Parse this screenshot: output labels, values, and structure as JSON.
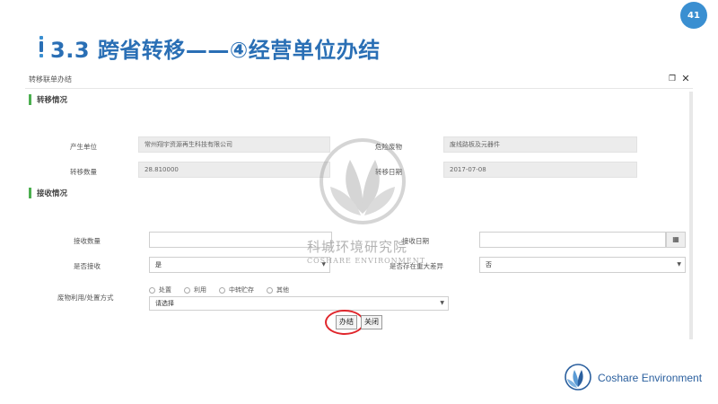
{
  "slide": {
    "title": "3.3 跨省转移——④经营单位办结",
    "page_number": "41",
    "accent_color": "#2a6fb5"
  },
  "dialog": {
    "title": "转移联单办结",
    "restore_icon": "restore-window-icon",
    "close_icon": "close-icon"
  },
  "transfer_section": {
    "heading": "转移情况",
    "producer_label": "产生单位",
    "producer_value": "常州翔宇资源再生科技有限公司",
    "waste_label": "危险废物",
    "waste_value": "废线路板及元器件",
    "quantity_label": "转移数量",
    "quantity_value": "28.810000",
    "date_label": "转移日期",
    "date_value": "2017-07-08"
  },
  "receive_section": {
    "heading": "接收情况",
    "recv_qty_label": "接收数量",
    "recv_qty_value": "",
    "recv_date_label": "接收日期",
    "recv_date_value": "",
    "accepted_label": "是否接收",
    "accepted_value": "是",
    "discrepancy_label": "是否存在重大差异",
    "discrepancy_value": "否",
    "method_label": "废物利用/处置方式",
    "method_options": [
      "处置",
      "利用",
      "中转贮存",
      "其他"
    ],
    "method_select_placeholder": "请选择"
  },
  "buttons": {
    "finish": "办结",
    "close": "关闭"
  },
  "watermark": {
    "cn": "科城环境研究院",
    "en": "COSHARE ENVIRONMENT"
  },
  "brand": {
    "name": "Coshare Environment"
  },
  "colors": {
    "section_marker": "#4caf50",
    "highlight_ring": "#e0262c",
    "page_badge": "#3a8fd1"
  }
}
